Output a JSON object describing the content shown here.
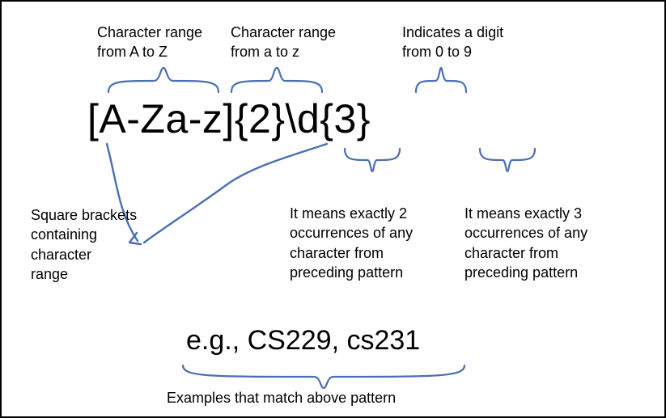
{
  "labels": {
    "top_left": "Character range\nfrom A to Z",
    "top_mid": "Character range\nfrom a to z",
    "top_right": "Indicates a digit\nfrom 0 to 9",
    "left_below": "Square brackets\ncontaining\ncharacter\nrange",
    "mid_below": "It means exactly 2\noccurrences of any\ncharacter from\npreceding pattern",
    "right_below": "It means exactly 3\noccurrences of any\ncharacter from\npreceding pattern",
    "examples_caption": "Examples that match above pattern"
  },
  "regex_parts": {
    "p1": "[",
    "p2": "A-Z",
    "p3": "a-z",
    "p4": "]",
    "p5": "{2}",
    "p6": "\\d",
    "p7": "{3}"
  },
  "examples": "e.g., CS229, cs231",
  "colors": {
    "brace": "#4a6fb5",
    "text": "#000000"
  },
  "chart_data": {
    "type": "table",
    "title": "Regex pattern annotated with explanations",
    "pattern": "[A-Za-z]{2}\\d{3}",
    "segments": [
      {
        "text": "[A-Z",
        "explanation": "Character range from A to Z"
      },
      {
        "text": "a-z]",
        "explanation": "Character range from a to z"
      },
      {
        "text": "[  ]",
        "explanation": "Square brackets containing character range"
      },
      {
        "text": "{2}",
        "explanation": "It means exactly 2 occurrences of any character from preceding pattern"
      },
      {
        "text": "\\d",
        "explanation": "Indicates a digit from 0 to 9"
      },
      {
        "text": "{3}",
        "explanation": "It means exactly 3 occurrences of any character from preceding pattern"
      }
    ],
    "examples": [
      "CS229",
      "cs231"
    ]
  }
}
